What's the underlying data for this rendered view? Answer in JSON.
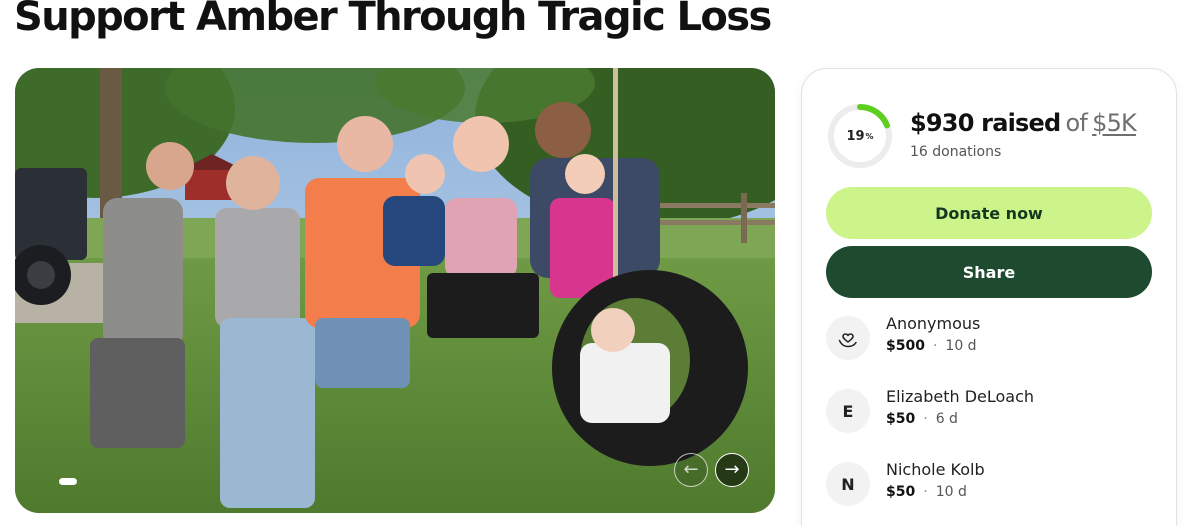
{
  "page": {
    "title": "Support Amber Through Tragic Loss"
  },
  "gallery": {
    "prev_glyph": "←",
    "next_glyph": "→"
  },
  "fundraiser": {
    "percent_label": "19",
    "percent_symbol": "%",
    "progress_fraction": 0.19,
    "raised_amount": "$930 raised",
    "of_label": "of",
    "goal": "$5K",
    "donation_count": "16 donations",
    "donate_label": "Donate now",
    "share_label": "Share"
  },
  "donations": [
    {
      "initial": "",
      "icon": "heart-hand-icon",
      "name": "Anonymous",
      "amount": "$500",
      "time": "10 d"
    },
    {
      "initial": "E",
      "name": "Elizabeth DeLoach",
      "amount": "$50",
      "time": "6 d"
    },
    {
      "initial": "N",
      "name": "Nichole Kolb",
      "amount": "$50",
      "time": "10 d"
    }
  ],
  "colors": {
    "accent_green": "#cdf48a",
    "dark_green": "#1e4a30",
    "progress_green": "#5ecf1e"
  }
}
